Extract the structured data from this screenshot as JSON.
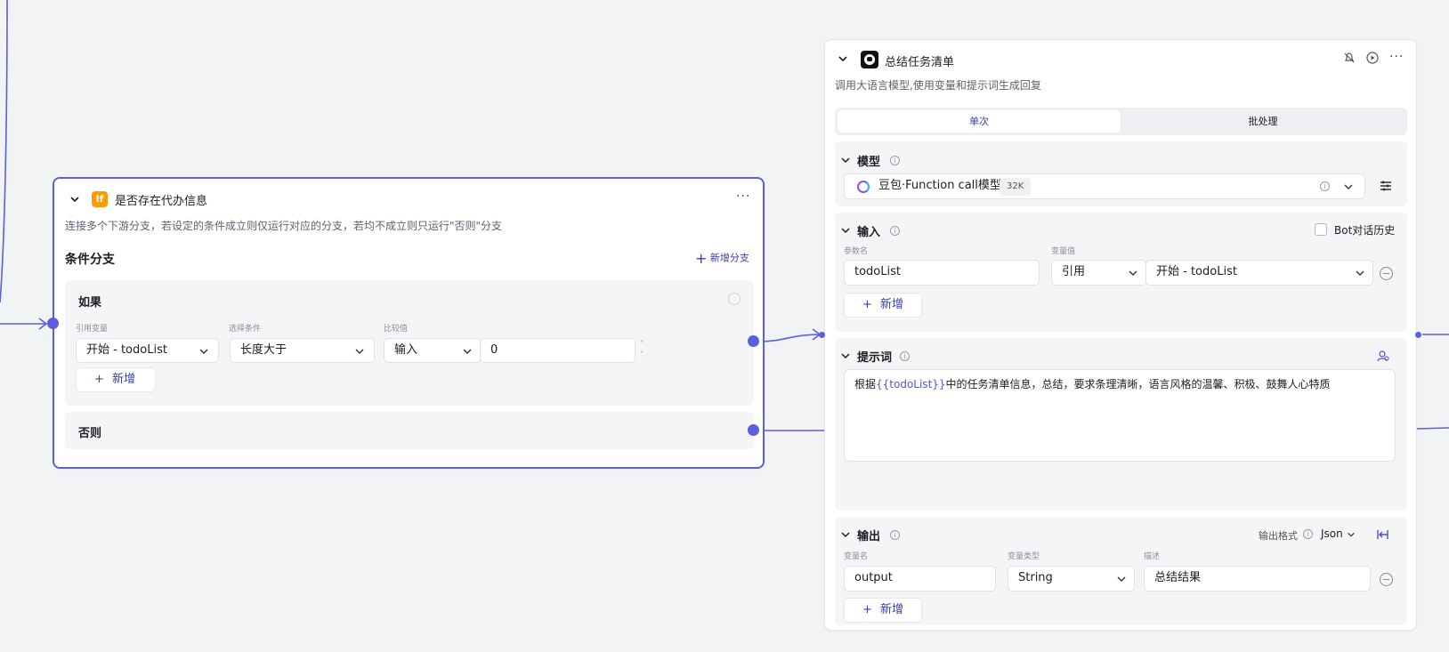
{
  "if_node": {
    "title": "是否存在代办信息",
    "description": "连接多个下游分支，若设定的条件成立则仅运行对应的分支，若均不成立则只运行\"否则\"分支",
    "section_title": "条件分支",
    "add_branch_label": "新增分支",
    "if_label": "如果",
    "col_ref_var": "引用变量",
    "col_condition": "选择条件",
    "col_compare": "比较值",
    "ref_var_value": "开始 - todoList",
    "condition_value": "长度大于",
    "compare_type": "输入",
    "compare_value": "0",
    "add_label": "新增",
    "else_label": "否则"
  },
  "llm_node": {
    "title": "总结任务清单",
    "description": "调用大语言模型,使用变量和提示词生成回复",
    "tab_single": "单次",
    "tab_batch": "批处理",
    "model_section": "模型",
    "model_name": "豆包·Function call模型",
    "model_badge": "32K",
    "input_section": "输入",
    "bot_history_label": "Bot对话历史",
    "col_param_name": "参数名",
    "col_var_value": "变量值",
    "param_name": "todoList",
    "ref_type": "引用",
    "ref_value": "开始 - todoList",
    "add_label": "新增",
    "prompt_section": "提示词",
    "prompt_prefix": "根据",
    "prompt_var": "{{todoList}}",
    "prompt_suffix": "中的任务清单信息，总结，要求条理清晰，语言风格的温馨、积极、鼓舞人心特质",
    "output_section": "输出",
    "output_format_label": "输出格式",
    "output_format_value": "Json",
    "col_var_name": "变量名",
    "col_var_type": "变量类型",
    "col_desc": "描述",
    "output_name": "output",
    "output_type": "String",
    "output_desc": "总结结果",
    "add_label2": "新增"
  },
  "colors": {
    "accent": "#5a5fe0",
    "if_icon": "#ff9a00",
    "canvas": "#f2f3f5"
  }
}
